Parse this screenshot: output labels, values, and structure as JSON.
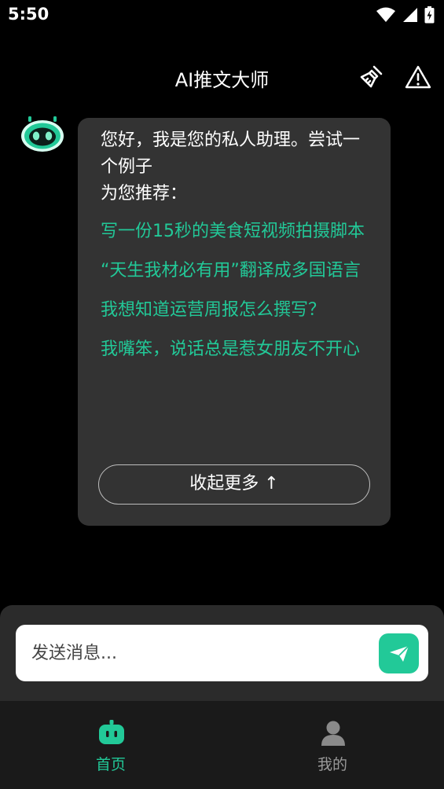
{
  "status_bar": {
    "time": "5:50"
  },
  "header": {
    "title": "AI推文大师",
    "clean_icon": "broom-icon",
    "report_icon": "warning-icon"
  },
  "chat": {
    "greeting_line1": "您好，我是您的私人助理。尝试一个例子",
    "greeting_line2": "为您推荐：",
    "suggestions": [
      "写一份15秒的美食短视频拍摄脚本",
      "“天生我材必有用”翻译成多国语言",
      "我想知道运营周报怎么撰写？",
      "我嘴笨，说话总是惹女朋友不开心"
    ],
    "collapse_label": "收起更多 ↑"
  },
  "input": {
    "placeholder": "发送消息..."
  },
  "tabs": [
    {
      "label": "首页",
      "active": true
    },
    {
      "label": "我的",
      "active": false
    }
  ],
  "colors": {
    "accent": "#22c998",
    "bubble": "#333333",
    "background": "#000000",
    "inactive": "#8a8a8a"
  }
}
